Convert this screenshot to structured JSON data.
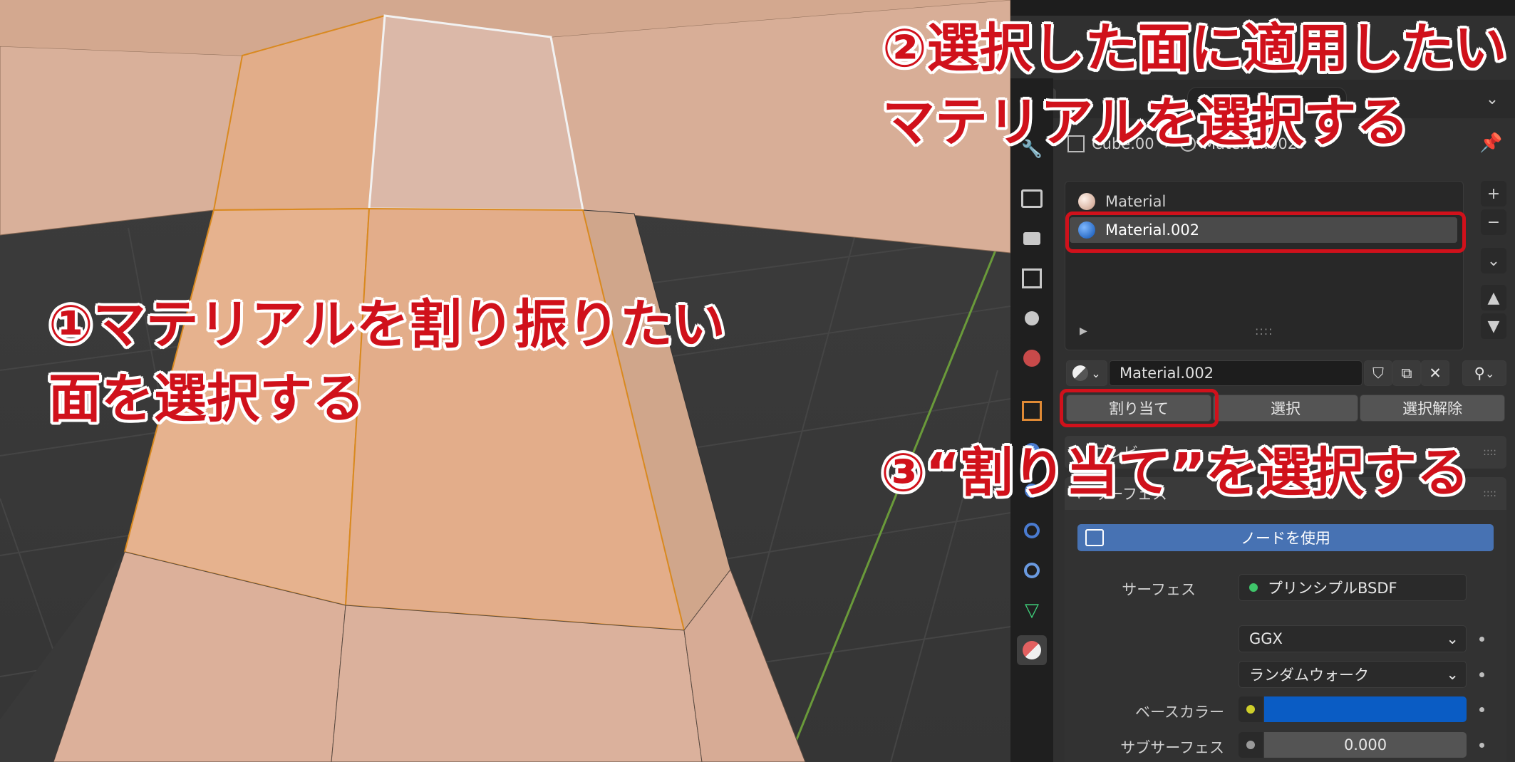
{
  "header": {
    "object_name": "Cube.00",
    "material_name": "Material.002"
  },
  "material_slots": [
    {
      "label": "Material",
      "color": "#e2b9a4"
    },
    {
      "label": "Material.002",
      "color": "#1f6fd6"
    }
  ],
  "material_selector": {
    "value": "Material.002"
  },
  "assign_buttons": {
    "assign": "割り当て",
    "select": "選択",
    "deselect": "選択解除"
  },
  "panels": {
    "preview_label": "プレビュー",
    "surface_label": "サーフェス"
  },
  "use_nodes_button": "ノードを使用",
  "surface_props": {
    "surface_label": "サーフェス",
    "surface_value": "プリンシプルBSDF",
    "distribution": "GGX",
    "subsurface_method": "ランダムウォーク",
    "base_color_label": "ベースカラー",
    "base_color": "#0a5cc4",
    "subsurface_label": "サブサーフェス",
    "subsurface_value": "0.000"
  },
  "annotations": {
    "step1_line1": "①マテリアルを割り振りたい",
    "step1_line2": "面を選択する",
    "step2_line1": "②選択した面に適用したい",
    "step2_line2": "マテリアルを選択する",
    "step3": "③“割り当て”を選択する"
  },
  "colors": {
    "annotation_red": "#d0111b",
    "mesh_face": "#d9a484",
    "selected_face": "#e3b08c",
    "active_face": "#dbb8a8",
    "accent_blue": "#4772b3"
  }
}
